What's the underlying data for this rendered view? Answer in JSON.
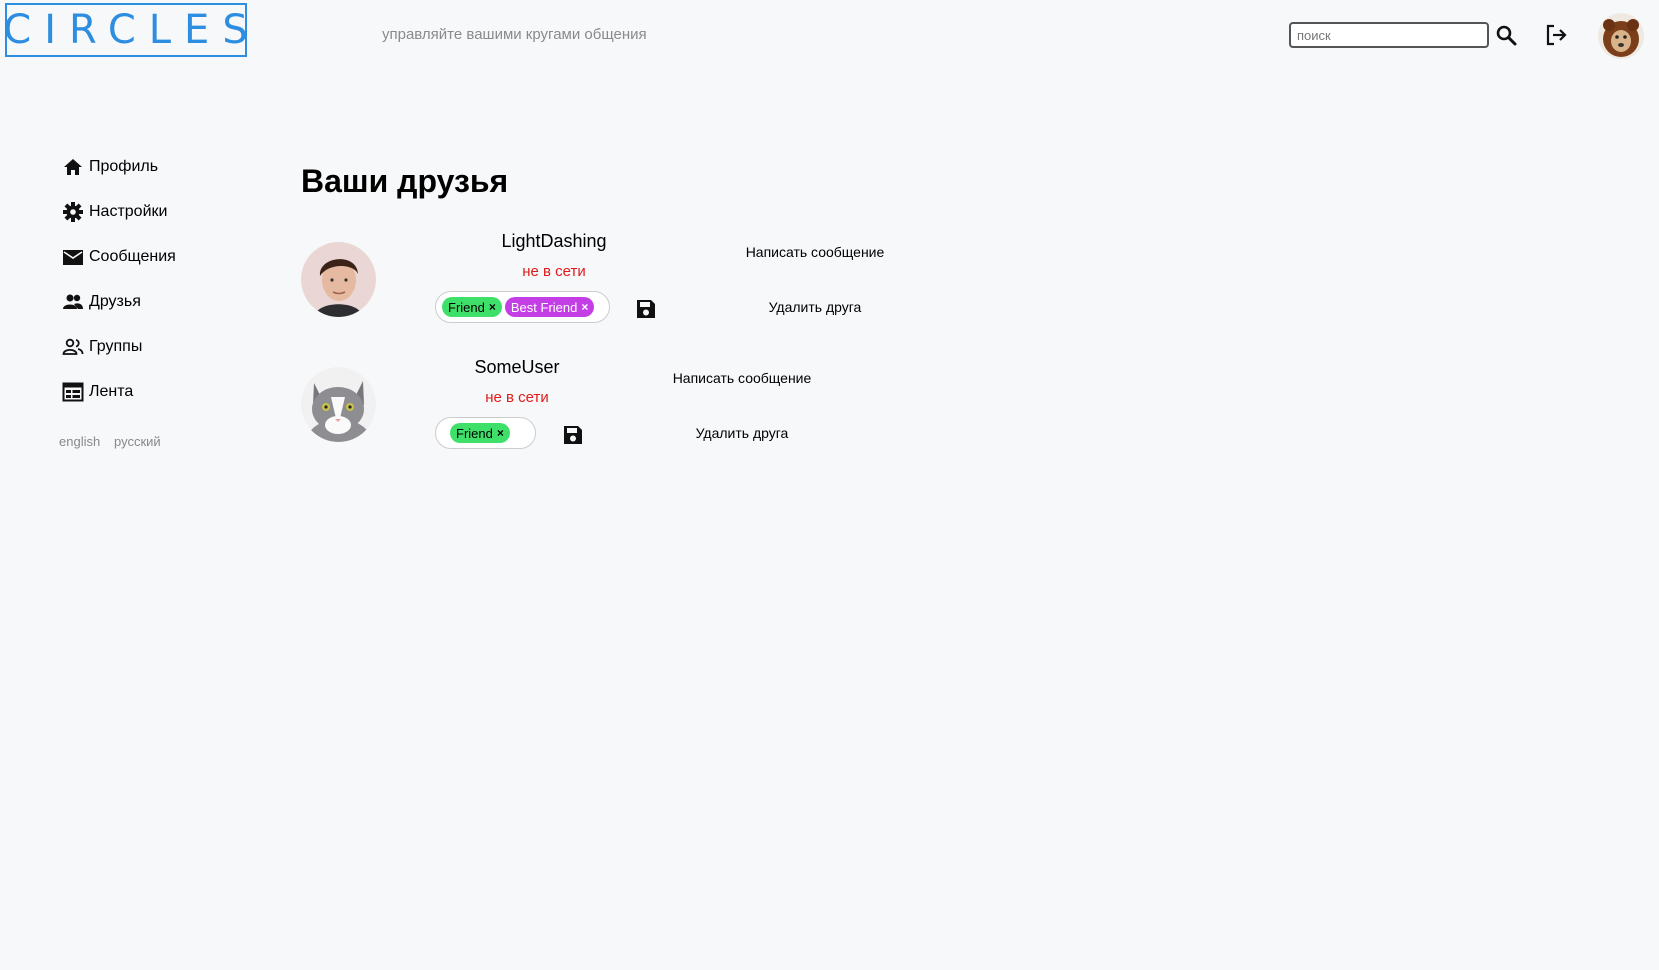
{
  "header": {
    "logo": "CIRCLES",
    "tagline": "управляйте вашими кругами общения",
    "search_placeholder": "поиск",
    "search_icon": "search-icon",
    "logout_icon": "logout-icon"
  },
  "sidebar": {
    "items": [
      {
        "label": "Профиль",
        "icon": "home-icon"
      },
      {
        "label": "Настройки",
        "icon": "gear-icon"
      },
      {
        "label": "Сообщения",
        "icon": "mail-icon"
      },
      {
        "label": "Друзья",
        "icon": "people-icon"
      },
      {
        "label": "Группы",
        "icon": "group-icon"
      },
      {
        "label": "Лента",
        "icon": "feed-icon"
      }
    ],
    "languages": [
      "english",
      "русский"
    ]
  },
  "main": {
    "title": "Ваши друзья",
    "friends": [
      {
        "name": "LightDashing",
        "status": "не в сети",
        "tags": [
          {
            "label": "Friend",
            "color": "#3ee06a"
          },
          {
            "label": "Best Friend",
            "color": "#c43ee6"
          }
        ],
        "message_label": "Написать сообщение",
        "remove_label": "Удалить друга"
      },
      {
        "name": "SomeUser",
        "status": "не в сети",
        "tags": [
          {
            "label": "Friend",
            "color": "#3ee06a"
          }
        ],
        "message_label": "Написать сообщение",
        "remove_label": "Удалить друга"
      }
    ]
  },
  "colors": {
    "brand": "#2d8de0",
    "offline": "#e01b1b",
    "background": "#f7f8fa"
  }
}
